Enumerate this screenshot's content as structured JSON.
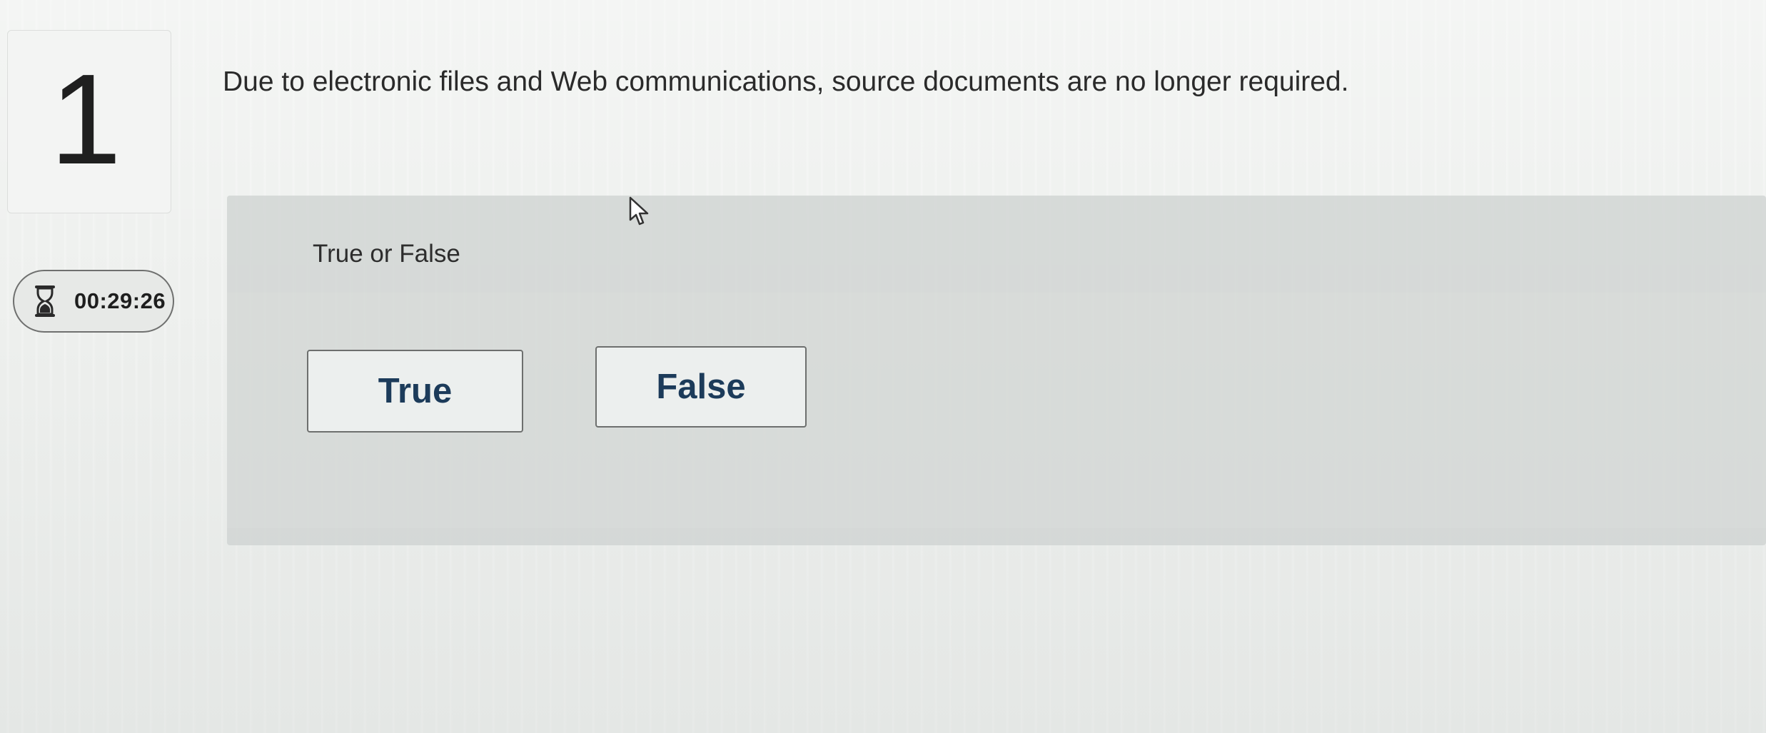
{
  "question": {
    "number": "1",
    "text": "Due to electronic files and Web communications, source documents are no longer required."
  },
  "timer": {
    "icon": "hourglass-icon",
    "value": "00:29:26"
  },
  "answer": {
    "prompt": "True or False",
    "choices": [
      {
        "label": "True"
      },
      {
        "label": "False"
      }
    ]
  },
  "colors": {
    "button_text": "#1c3b5a",
    "panel": "#cfd3d1",
    "background": "#eef0ee"
  }
}
